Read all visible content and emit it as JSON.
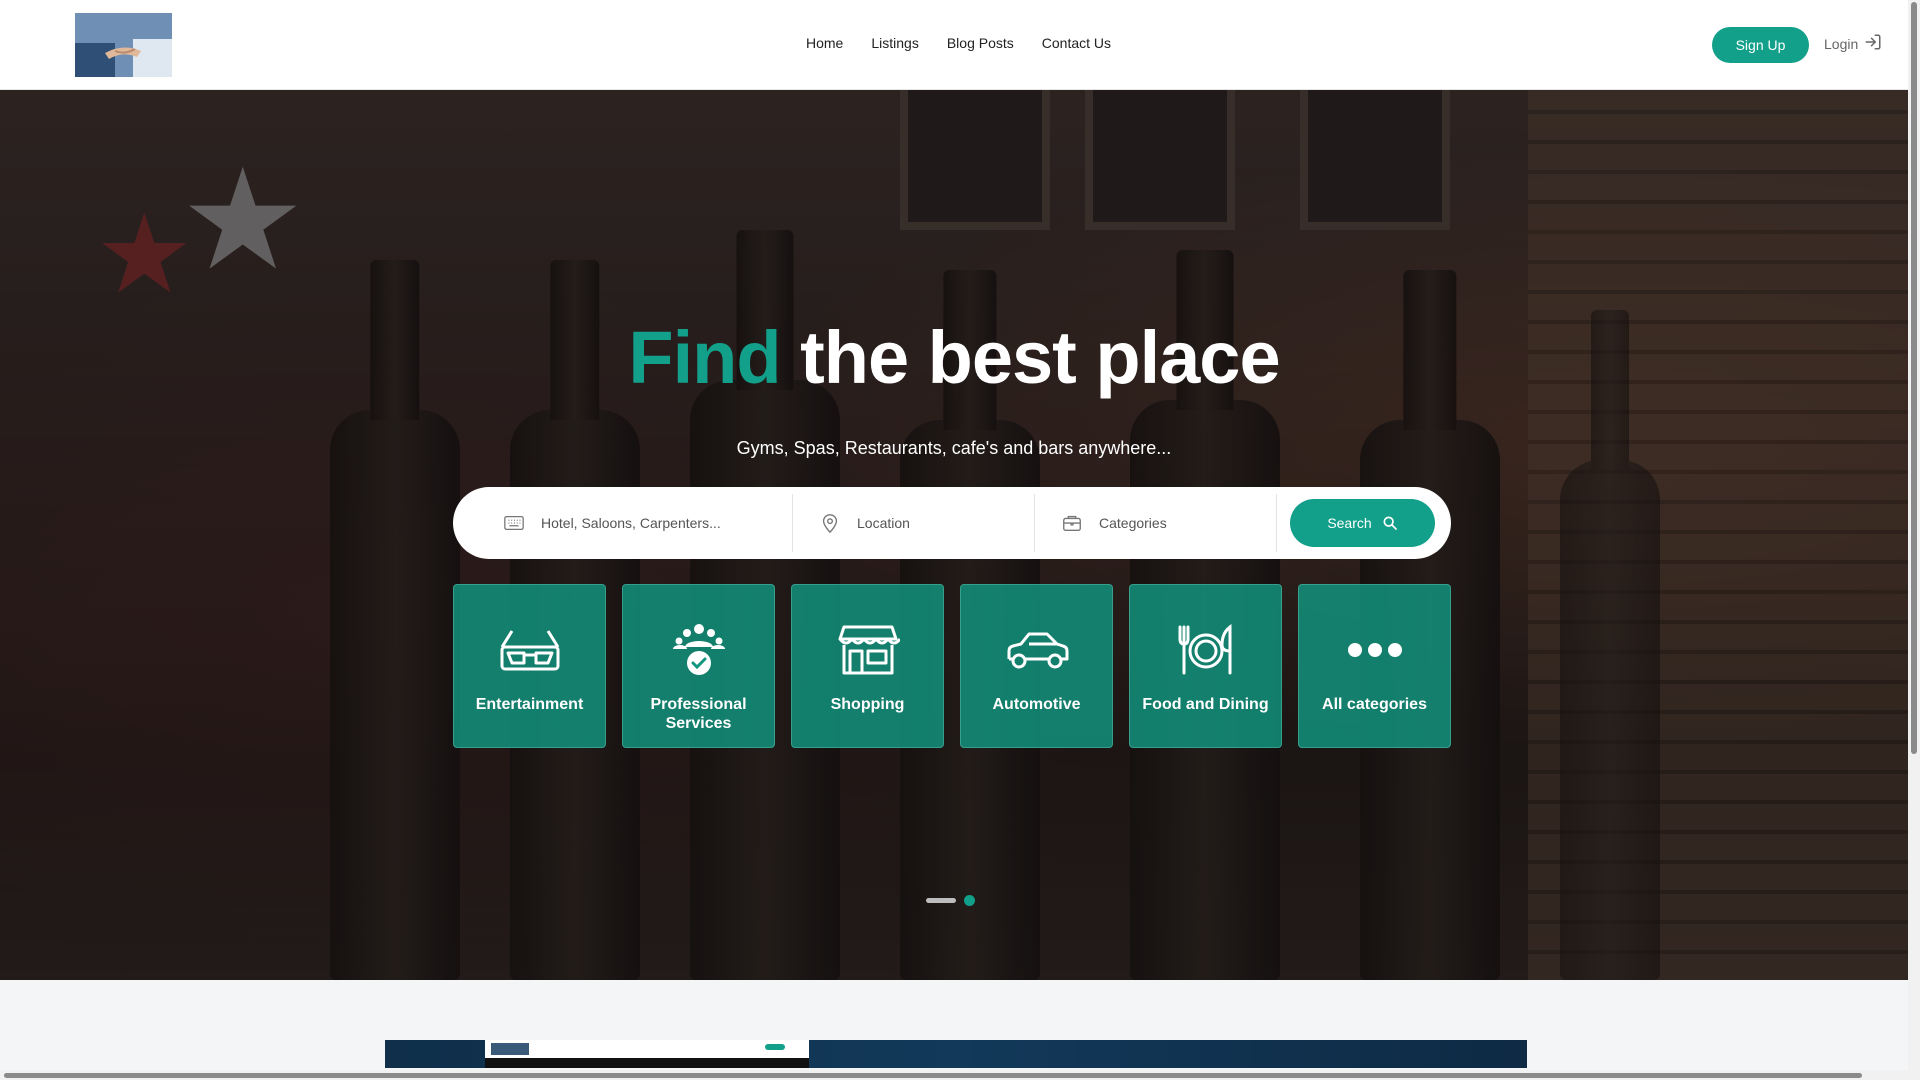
{
  "header": {
    "nav": [
      "Home",
      "Listings",
      "Blog Posts",
      "Contact Us"
    ],
    "signup_label": "Sign Up",
    "login_label": "Login"
  },
  "hero": {
    "headline_accent": "Find",
    "headline_rest": "the best place",
    "subtitle": "Gyms, Spas, Restaurants, cafe's and bars anywhere...",
    "search": {
      "keyword_placeholder": "Hotel, Saloons, Carpenters...",
      "location_placeholder": "Location",
      "category_placeholder": "Categories",
      "button_label": "Search"
    },
    "categories": [
      {
        "label": "Entertainment",
        "icon": "3d-glasses-icon"
      },
      {
        "label": "Professional Services",
        "icon": "team-badge-icon"
      },
      {
        "label": "Shopping",
        "icon": "storefront-icon"
      },
      {
        "label": "Automotive",
        "icon": "car-icon"
      },
      {
        "label": "Food and Dining",
        "icon": "plate-cutlery-icon"
      },
      {
        "label": "All categories",
        "icon": "more-dots-icon"
      }
    ],
    "carousel": {
      "active_slide": 2,
      "total_slides": 2
    }
  },
  "colors": {
    "accent": "#12a08a",
    "header_bg": "#ffffff",
    "page_bg": "#f4f5f7"
  }
}
